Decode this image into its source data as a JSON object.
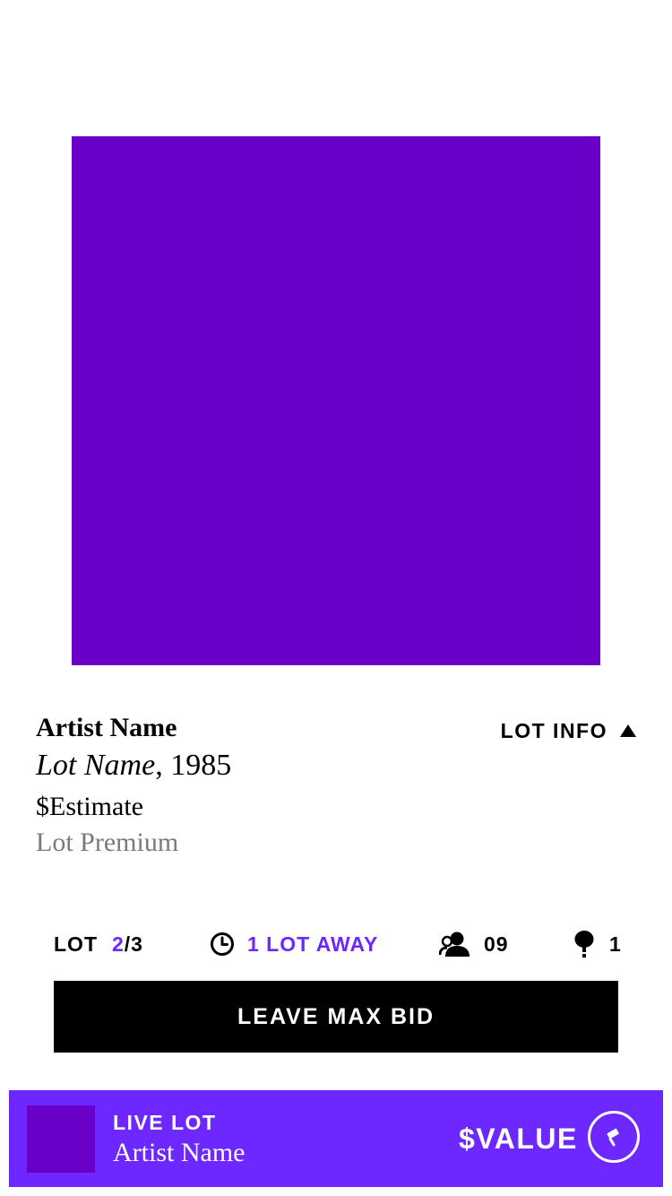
{
  "artwork": {
    "color": "#6a00c8"
  },
  "lot": {
    "artist": "Artist Name",
    "name": "Lot Name",
    "year_suffix": ", 1985",
    "estimate": "$Estimate",
    "premium": "Lot Premium",
    "info_label": "LOT INFO",
    "info_icon": "caret-up-icon"
  },
  "stats": {
    "lot_label": "LOT",
    "lot_current": "2",
    "lot_total": "/3",
    "time_icon": "clock-icon",
    "time_label": "1 LOT AWAY",
    "users_icon": "users-icon",
    "users_count": "09",
    "paddles_icon": "paddle-icon",
    "paddles_count": "1"
  },
  "actions": {
    "max_bid_label": "LEAVE MAX BID"
  },
  "live_bar": {
    "label": "LIVE LOT",
    "artist": "Artist Name",
    "value": "$VALUE",
    "action_icon": "gavel-icon",
    "background": "#6d28ff",
    "thumb_color": "#6a00c8"
  },
  "colors": {
    "accent": "#6d28ff",
    "artwork": "#6a00c8",
    "premium_text": "#7a7a7a"
  }
}
